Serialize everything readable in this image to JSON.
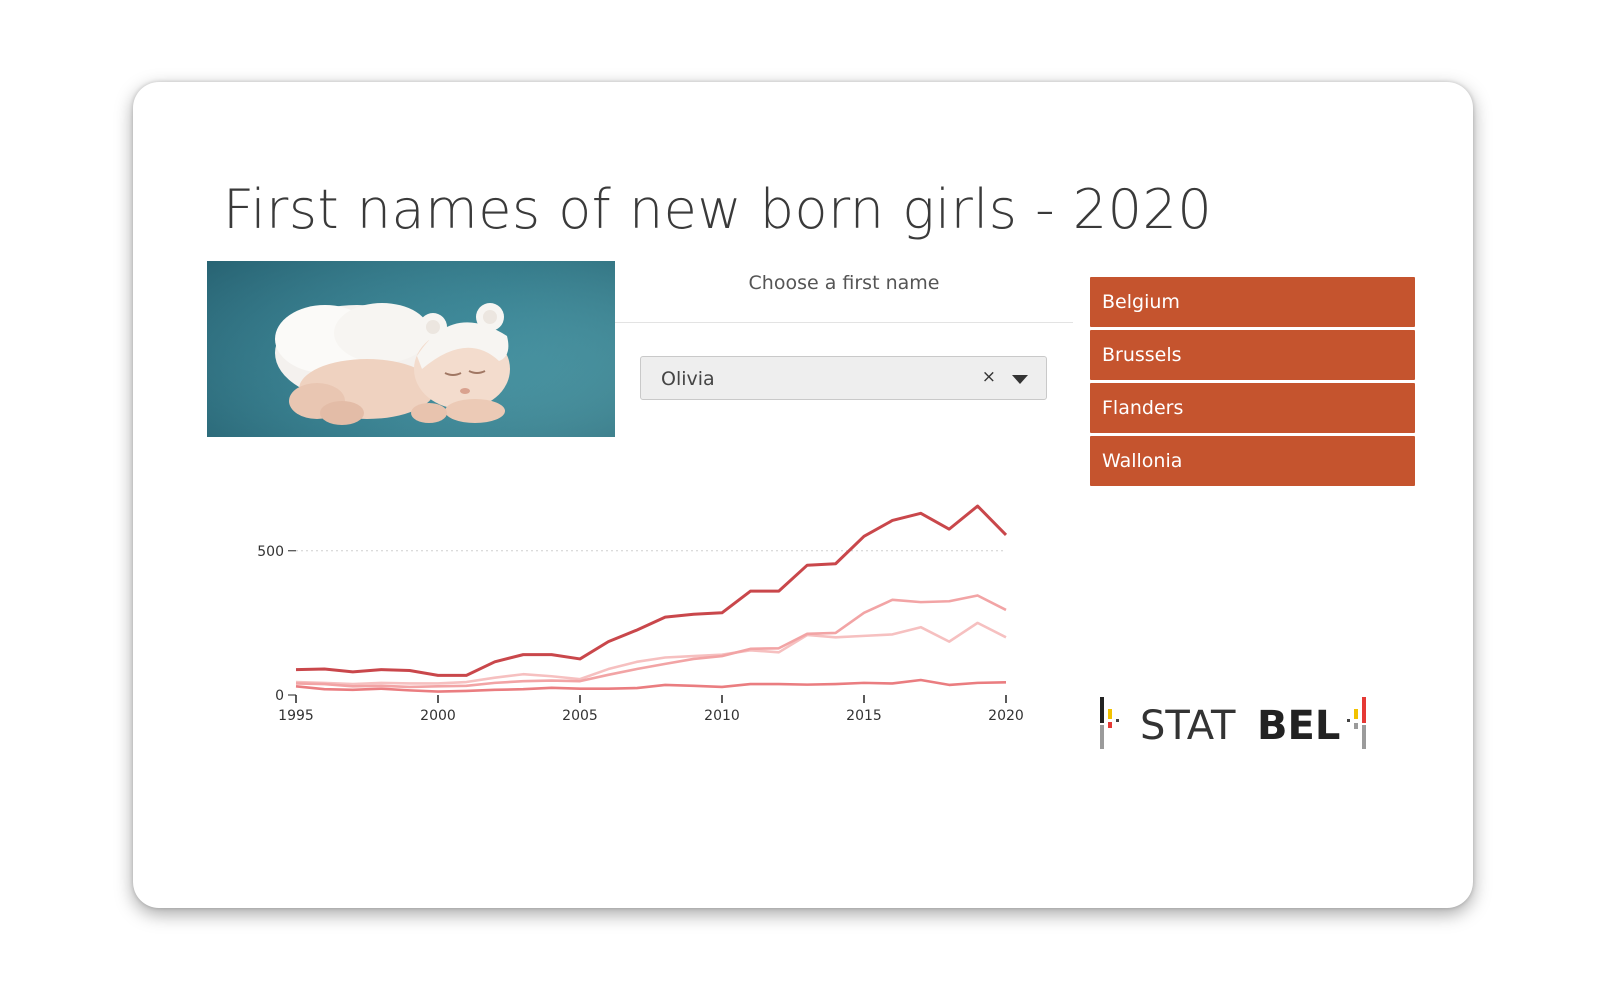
{
  "page": {
    "title": "First names of new born girls - 2020"
  },
  "filter": {
    "label": "Choose a first name",
    "selected": "Olivia",
    "clear_symbol": "×"
  },
  "regions": {
    "items": [
      {
        "label": "Belgium"
      },
      {
        "label": "Brussels"
      },
      {
        "label": "Flanders"
      },
      {
        "label": "Wallonia"
      }
    ],
    "color": "#c5542e"
  },
  "logo": {
    "text": "STATBEL",
    "parts": [
      "STAT",
      "BEL"
    ]
  },
  "chart_data": {
    "type": "line",
    "title": "",
    "xlabel": "",
    "ylabel": "",
    "x": [
      1995,
      1996,
      1997,
      1998,
      1999,
      2000,
      2001,
      2002,
      2003,
      2004,
      2005,
      2006,
      2007,
      2008,
      2009,
      2010,
      2011,
      2012,
      2013,
      2014,
      2015,
      2016,
      2017,
      2018,
      2019,
      2020
    ],
    "xlim": [
      1995,
      2020
    ],
    "ylim": [
      0,
      780
    ],
    "x_ticks": [
      1995,
      2000,
      2005,
      2010,
      2015,
      2020
    ],
    "y_ticks": [
      0,
      500
    ],
    "y_tick_labels": [
      "0",
      "500"
    ],
    "x_tick_labels": [
      "1995",
      "2000",
      "2005",
      "2010",
      "2015",
      "2020"
    ],
    "grid": "horizontal dotted at 500",
    "series": [
      {
        "color": "#c9474b",
        "values": [
          88,
          90,
          80,
          88,
          85,
          68,
          68,
          115,
          140,
          140,
          125,
          185,
          225,
          270,
          280,
          285,
          360,
          360,
          450,
          455,
          550,
          605,
          630,
          575,
          655,
          555
        ]
      },
      {
        "color": "#f2a4a5",
        "values": [
          40,
          38,
          30,
          32,
          28,
          30,
          32,
          42,
          48,
          50,
          48,
          70,
          90,
          108,
          125,
          135,
          160,
          162,
          212,
          215,
          285,
          330,
          322,
          325,
          345,
          295
        ]
      },
      {
        "color": "#f6c0c0",
        "values": [
          45,
          42,
          38,
          42,
          40,
          40,
          45,
          60,
          72,
          65,
          55,
          90,
          115,
          130,
          135,
          140,
          155,
          148,
          208,
          200,
          205,
          210,
          235,
          185,
          250,
          200
        ]
      },
      {
        "color": "#ea7d80",
        "values": [
          30,
          20,
          18,
          22,
          16,
          12,
          14,
          18,
          20,
          25,
          22,
          22,
          24,
          35,
          32,
          28,
          38,
          38,
          36,
          38,
          42,
          40,
          52,
          35,
          42,
          44
        ]
      }
    ]
  }
}
